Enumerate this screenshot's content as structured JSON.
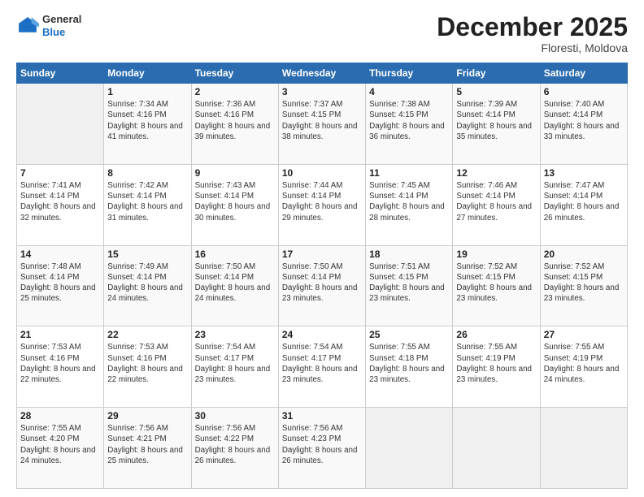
{
  "header": {
    "logo": {
      "general": "General",
      "blue": "Blue"
    },
    "month": "December 2025",
    "location": "Floresti, Moldova"
  },
  "weekdays": [
    "Sunday",
    "Monday",
    "Tuesday",
    "Wednesday",
    "Thursday",
    "Friday",
    "Saturday"
  ],
  "weeks": [
    [
      {
        "day": "",
        "sunrise": "",
        "sunset": "",
        "daylight": ""
      },
      {
        "day": "1",
        "sunrise": "Sunrise: 7:34 AM",
        "sunset": "Sunset: 4:16 PM",
        "daylight": "Daylight: 8 hours and 41 minutes."
      },
      {
        "day": "2",
        "sunrise": "Sunrise: 7:36 AM",
        "sunset": "Sunset: 4:16 PM",
        "daylight": "Daylight: 8 hours and 39 minutes."
      },
      {
        "day": "3",
        "sunrise": "Sunrise: 7:37 AM",
        "sunset": "Sunset: 4:15 PM",
        "daylight": "Daylight: 8 hours and 38 minutes."
      },
      {
        "day": "4",
        "sunrise": "Sunrise: 7:38 AM",
        "sunset": "Sunset: 4:15 PM",
        "daylight": "Daylight: 8 hours and 36 minutes."
      },
      {
        "day": "5",
        "sunrise": "Sunrise: 7:39 AM",
        "sunset": "Sunset: 4:14 PM",
        "daylight": "Daylight: 8 hours and 35 minutes."
      },
      {
        "day": "6",
        "sunrise": "Sunrise: 7:40 AM",
        "sunset": "Sunset: 4:14 PM",
        "daylight": "Daylight: 8 hours and 33 minutes."
      }
    ],
    [
      {
        "day": "7",
        "sunrise": "Sunrise: 7:41 AM",
        "sunset": "Sunset: 4:14 PM",
        "daylight": "Daylight: 8 hours and 32 minutes."
      },
      {
        "day": "8",
        "sunrise": "Sunrise: 7:42 AM",
        "sunset": "Sunset: 4:14 PM",
        "daylight": "Daylight: 8 hours and 31 minutes."
      },
      {
        "day": "9",
        "sunrise": "Sunrise: 7:43 AM",
        "sunset": "Sunset: 4:14 PM",
        "daylight": "Daylight: 8 hours and 30 minutes."
      },
      {
        "day": "10",
        "sunrise": "Sunrise: 7:44 AM",
        "sunset": "Sunset: 4:14 PM",
        "daylight": "Daylight: 8 hours and 29 minutes."
      },
      {
        "day": "11",
        "sunrise": "Sunrise: 7:45 AM",
        "sunset": "Sunset: 4:14 PM",
        "daylight": "Daylight: 8 hours and 28 minutes."
      },
      {
        "day": "12",
        "sunrise": "Sunrise: 7:46 AM",
        "sunset": "Sunset: 4:14 PM",
        "daylight": "Daylight: 8 hours and 27 minutes."
      },
      {
        "day": "13",
        "sunrise": "Sunrise: 7:47 AM",
        "sunset": "Sunset: 4:14 PM",
        "daylight": "Daylight: 8 hours and 26 minutes."
      }
    ],
    [
      {
        "day": "14",
        "sunrise": "Sunrise: 7:48 AM",
        "sunset": "Sunset: 4:14 PM",
        "daylight": "Daylight: 8 hours and 25 minutes."
      },
      {
        "day": "15",
        "sunrise": "Sunrise: 7:49 AM",
        "sunset": "Sunset: 4:14 PM",
        "daylight": "Daylight: 8 hours and 24 minutes."
      },
      {
        "day": "16",
        "sunrise": "Sunrise: 7:50 AM",
        "sunset": "Sunset: 4:14 PM",
        "daylight": "Daylight: 8 hours and 24 minutes."
      },
      {
        "day": "17",
        "sunrise": "Sunrise: 7:50 AM",
        "sunset": "Sunset: 4:14 PM",
        "daylight": "Daylight: 8 hours and 23 minutes."
      },
      {
        "day": "18",
        "sunrise": "Sunrise: 7:51 AM",
        "sunset": "Sunset: 4:15 PM",
        "daylight": "Daylight: 8 hours and 23 minutes."
      },
      {
        "day": "19",
        "sunrise": "Sunrise: 7:52 AM",
        "sunset": "Sunset: 4:15 PM",
        "daylight": "Daylight: 8 hours and 23 minutes."
      },
      {
        "day": "20",
        "sunrise": "Sunrise: 7:52 AM",
        "sunset": "Sunset: 4:15 PM",
        "daylight": "Daylight: 8 hours and 23 minutes."
      }
    ],
    [
      {
        "day": "21",
        "sunrise": "Sunrise: 7:53 AM",
        "sunset": "Sunset: 4:16 PM",
        "daylight": "Daylight: 8 hours and 22 minutes."
      },
      {
        "day": "22",
        "sunrise": "Sunrise: 7:53 AM",
        "sunset": "Sunset: 4:16 PM",
        "daylight": "Daylight: 8 hours and 22 minutes."
      },
      {
        "day": "23",
        "sunrise": "Sunrise: 7:54 AM",
        "sunset": "Sunset: 4:17 PM",
        "daylight": "Daylight: 8 hours and 23 minutes."
      },
      {
        "day": "24",
        "sunrise": "Sunrise: 7:54 AM",
        "sunset": "Sunset: 4:17 PM",
        "daylight": "Daylight: 8 hours and 23 minutes."
      },
      {
        "day": "25",
        "sunrise": "Sunrise: 7:55 AM",
        "sunset": "Sunset: 4:18 PM",
        "daylight": "Daylight: 8 hours and 23 minutes."
      },
      {
        "day": "26",
        "sunrise": "Sunrise: 7:55 AM",
        "sunset": "Sunset: 4:19 PM",
        "daylight": "Daylight: 8 hours and 23 minutes."
      },
      {
        "day": "27",
        "sunrise": "Sunrise: 7:55 AM",
        "sunset": "Sunset: 4:19 PM",
        "daylight": "Daylight: 8 hours and 24 minutes."
      }
    ],
    [
      {
        "day": "28",
        "sunrise": "Sunrise: 7:55 AM",
        "sunset": "Sunset: 4:20 PM",
        "daylight": "Daylight: 8 hours and 24 minutes."
      },
      {
        "day": "29",
        "sunrise": "Sunrise: 7:56 AM",
        "sunset": "Sunset: 4:21 PM",
        "daylight": "Daylight: 8 hours and 25 minutes."
      },
      {
        "day": "30",
        "sunrise": "Sunrise: 7:56 AM",
        "sunset": "Sunset: 4:22 PM",
        "daylight": "Daylight: 8 hours and 26 minutes."
      },
      {
        "day": "31",
        "sunrise": "Sunrise: 7:56 AM",
        "sunset": "Sunset: 4:23 PM",
        "daylight": "Daylight: 8 hours and 26 minutes."
      },
      {
        "day": "",
        "sunrise": "",
        "sunset": "",
        "daylight": ""
      },
      {
        "day": "",
        "sunrise": "",
        "sunset": "",
        "daylight": ""
      },
      {
        "day": "",
        "sunrise": "",
        "sunset": "",
        "daylight": ""
      }
    ]
  ]
}
